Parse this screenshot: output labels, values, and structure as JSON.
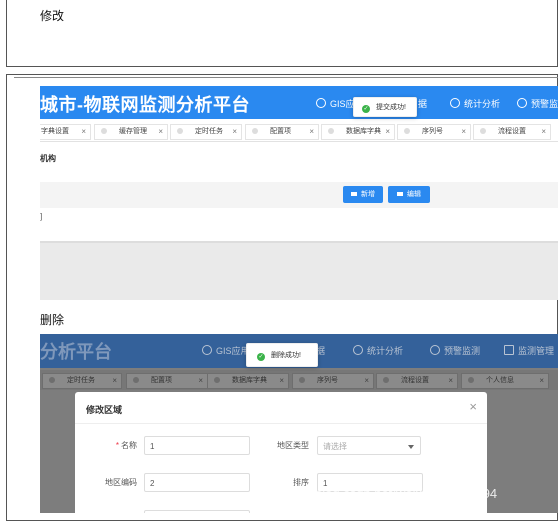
{
  "section1": {
    "caption": "修改"
  },
  "shot1": {
    "title": "城市-物联网监测分析平台",
    "nav": [
      "GIS应用",
      "据",
      "统计分析",
      "预警监测"
    ],
    "tabs": [
      "字典设置",
      "缓存管理",
      "定时任务",
      "配置项",
      "数据库字典",
      "序列号",
      "流程设置"
    ],
    "tab_close": "×",
    "subtitle": "机构",
    "buttons": {
      "add": "新增",
      "edit": "编辑"
    },
    "row_text": "]",
    "toast": "提交成功!"
  },
  "section2": {
    "caption": "删除"
  },
  "shot2": {
    "title": "分析平台",
    "nav": [
      "GIS应用",
      "据",
      "统计分析",
      "预警监测",
      "监测管理"
    ],
    "tabs": [
      "定时任务",
      "配置项",
      "数据库字典",
      "序列号",
      "流程设置",
      "个人信息"
    ],
    "tab_close": "×",
    "toast": "删除成功!",
    "modal": {
      "title": "修改区域",
      "close": "×",
      "fields": {
        "name_label": "名称",
        "name_value": "1",
        "region_type_label": "地区类型",
        "region_type_placeholder": "请选择",
        "region_code_label": "地区编码",
        "region_code_value": "2",
        "sort_label": "排序",
        "sort_value": "1"
      }
    }
  },
  "watermark": "https://blog.csdn.net/weixin_45038894"
}
